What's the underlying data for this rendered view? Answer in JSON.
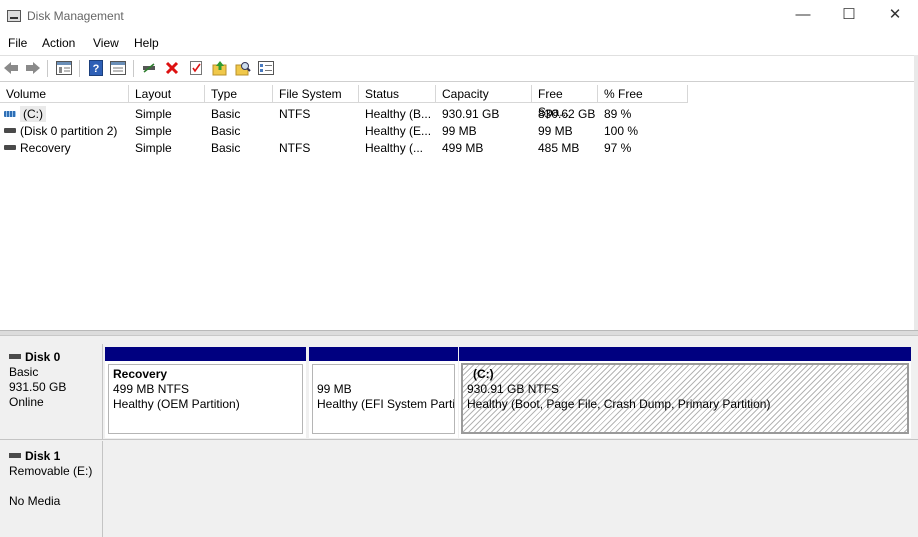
{
  "window": {
    "title": "Disk Management",
    "minimize": "—",
    "maximize": "☐",
    "close": "✕"
  },
  "menu": [
    "File",
    "Action",
    "View",
    "Help"
  ],
  "toolbar": {
    "icons": [
      "back-arrow-icon",
      "forward-arrow-icon",
      "console-tree-icon",
      "help-icon",
      "details-pane-icon",
      "connect-icon",
      "delete-icon",
      "properties-icon",
      "up-folder-icon",
      "find-icon",
      "list-view-icon"
    ]
  },
  "volume_list": {
    "columns": [
      "Volume",
      "Layout",
      "Type",
      "File System",
      "Status",
      "Capacity",
      "Free Spa...",
      "% Free"
    ],
    "rows": [
      {
        "volume": "(C:)",
        "layout": "Simple",
        "type": "Basic",
        "fs": "NTFS",
        "status": "Healthy (B...",
        "capacity": "930.91 GB",
        "free": "830.62 GB",
        "pct": "89 %",
        "icon": "blue"
      },
      {
        "volume": "(Disk 0 partition 2)",
        "layout": "Simple",
        "type": "Basic",
        "fs": "",
        "status": "Healthy (E...",
        "capacity": "99 MB",
        "free": "99 MB",
        "pct": "100 %",
        "icon": "grey"
      },
      {
        "volume": "Recovery",
        "layout": "Simple",
        "type": "Basic",
        "fs": "NTFS",
        "status": "Healthy (...",
        "capacity": "499 MB",
        "free": "485 MB",
        "pct": "97 %",
        "icon": "grey"
      }
    ]
  },
  "disks": [
    {
      "name": "Disk 0",
      "type": "Basic",
      "size": "931.50 GB",
      "state": "Online",
      "partitions": [
        {
          "label": "Recovery",
          "size": "499 MB NTFS",
          "status": "Healthy (OEM Partition)"
        },
        {
          "label": "",
          "size": "99 MB",
          "status": "Healthy (EFI System Partit"
        },
        {
          "label": "(C:)",
          "size": "930.91 GB NTFS",
          "status": "Healthy (Boot, Page File, Crash Dump, Primary Partition)"
        }
      ]
    },
    {
      "name": "Disk 1",
      "type": "Removable (E:)",
      "media": "No Media"
    }
  ]
}
